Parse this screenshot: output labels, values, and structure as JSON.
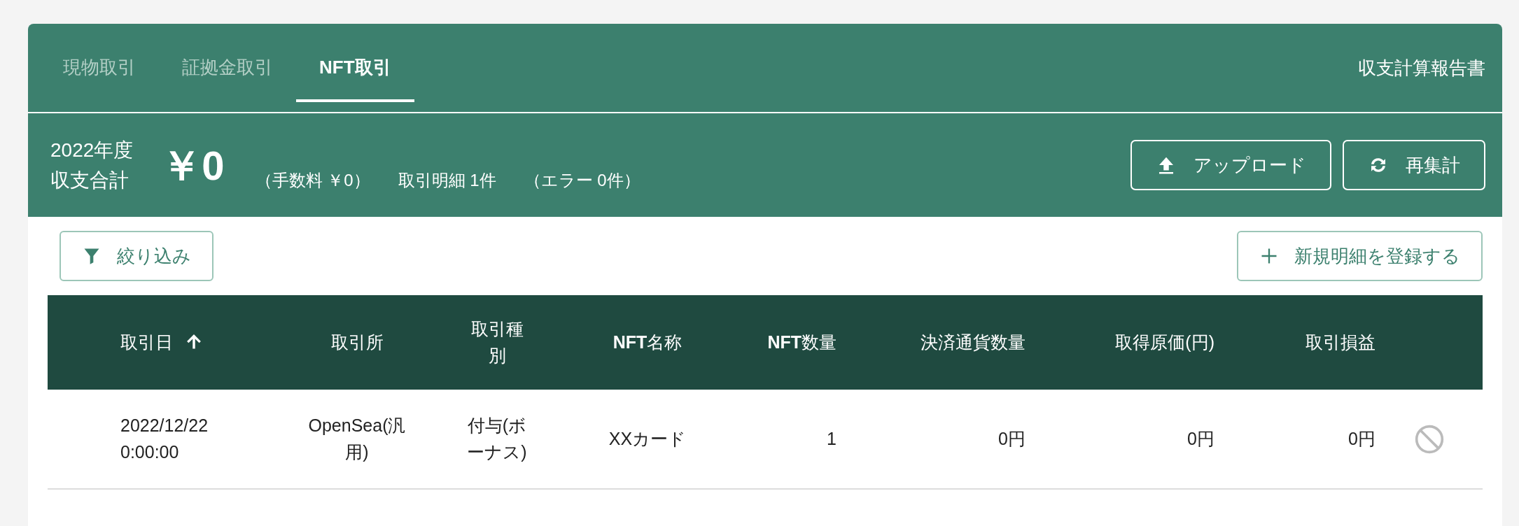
{
  "tabs": [
    {
      "label": "現物取引",
      "selected": false
    },
    {
      "label": "証拠金取引",
      "selected": false
    },
    {
      "label": "NFT取引",
      "selected": true
    }
  ],
  "report_link": "収支計算報告書",
  "summary": {
    "year_label": "2022年度",
    "total_label": "収支合計",
    "total": "￥0",
    "fee": "（手数料 ￥0）",
    "count": "取引明細 1件",
    "errors": "（エラー 0件）"
  },
  "header_buttons": [
    "アップロード",
    "再集計"
  ],
  "filter_button": "絞り込み",
  "new_button": "新規明細を登録する",
  "table": {
    "columns": [
      {
        "label": "取引日",
        "kind": "text",
        "sorted": true
      },
      {
        "label": "取引所",
        "kind": "center"
      },
      {
        "label": "取引種別",
        "kind": "center"
      },
      {
        "label": "**NFT**名称",
        "kind": "center"
      },
      {
        "label": "**NFT**数量",
        "kind": "number"
      },
      {
        "label": "決済通貨数量",
        "kind": "number"
      },
      {
        "label": "取得原価(円)",
        "kind": "number"
      },
      {
        "label": "取引損益",
        "kind": "number"
      }
    ],
    "rows": [
      {
        "cells": [
          "2022/12/22 0:00:00",
          "OpenSea(汎用)",
          "付与(ボーナス)",
          "XXカード",
          "1",
          "0円",
          "0円",
          "0円"
        ],
        "disabled": true
      }
    ]
  }
}
